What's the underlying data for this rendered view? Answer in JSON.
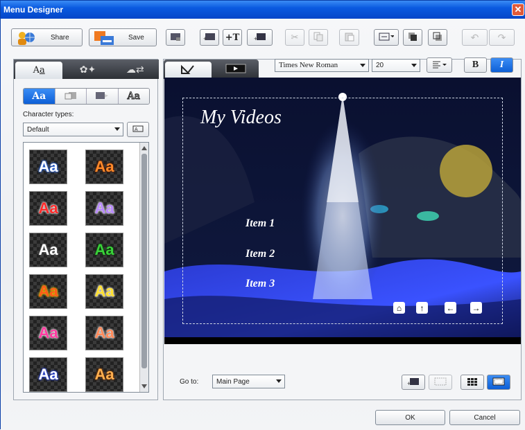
{
  "window": {
    "title": "Menu Designer",
    "close": "✕"
  },
  "toolbar": {
    "share_label": "Share",
    "save_label": "Save"
  },
  "left_panel": {
    "tabs": [
      {
        "icon": "text-style-icon"
      },
      {
        "icon": "effects-icon"
      },
      {
        "icon": "motion-icon"
      }
    ],
    "segment_sample": "Aa",
    "character_types_label": "Character types:",
    "character_type_value": "Default",
    "styles": [
      {
        "text": "Aa",
        "color": "#ffffff",
        "outline": "#2a6fff"
      },
      {
        "text": "Aa",
        "color": "#ff8a2a",
        "outline": "#5a1d00"
      },
      {
        "text": "Aa",
        "color": "#ff2a2a",
        "outline": "#ffffff"
      },
      {
        "text": "Aa",
        "color": "#b98aff",
        "outline": "#ffffff"
      },
      {
        "text": "Aa",
        "color": "#ffffff",
        "outline": "#555555"
      },
      {
        "text": "Aa",
        "color": "#3ad23a",
        "outline": "#0a3a0a"
      },
      {
        "text": "Aa",
        "color": "#ff5a1a",
        "outline": "#ffd000"
      },
      {
        "text": "Aa",
        "color": "#ffe030",
        "outline": "#ffffff"
      },
      {
        "text": "Aa",
        "color": "#ff3aa0",
        "outline": "#ffffff"
      },
      {
        "text": "Aa",
        "color": "#ff8a5a",
        "outline": "#ffffff"
      },
      {
        "text": "Aa",
        "color": "#ffffff",
        "outline": "#2a4aff"
      },
      {
        "text": "Aa",
        "color": "#ffb050",
        "outline": "#6a3000"
      }
    ]
  },
  "format_bar": {
    "font": "Times New Roman",
    "size": "20",
    "bold": "B",
    "italic": "I"
  },
  "preview": {
    "title": "My Videos",
    "items": [
      "Item 1",
      "Item 2",
      "Item 3"
    ],
    "nav_buttons": [
      "⌂",
      "↑",
      "←",
      "→"
    ]
  },
  "bottom": {
    "goto_label": "Go to:",
    "goto_value": "Main Page"
  },
  "dialog": {
    "ok_label": "OK",
    "cancel_label": "Cancel"
  }
}
